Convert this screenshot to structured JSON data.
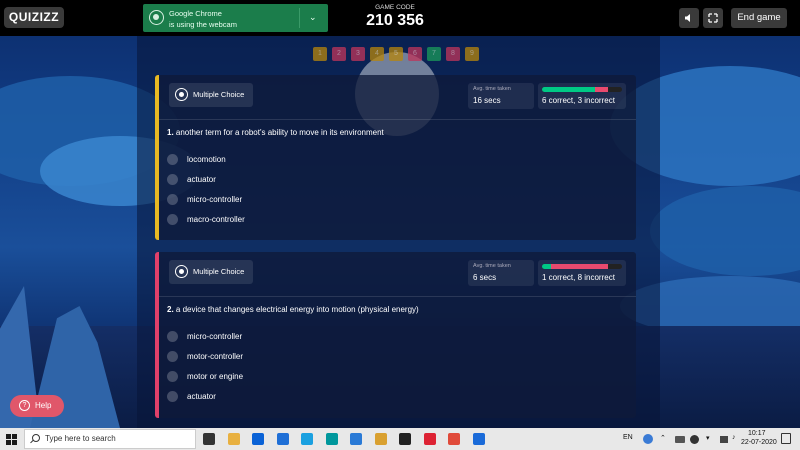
{
  "header": {
    "logo": "QUIZIZZ",
    "webcam_notice": {
      "line1": "Google Chrome",
      "line2": "is using the webcam"
    },
    "game_code_label": "GAME CODE",
    "game_code": "210 356",
    "mute_icon": "speaker-icon",
    "fullscreen_icon": "fullscreen-icon",
    "end_game_label": "End game"
  },
  "question_nav": {
    "items": [
      {
        "label": "1",
        "color": "#b8860b"
      },
      {
        "label": "2",
        "color": "#c0355a"
      },
      {
        "label": "3",
        "color": "#c0355a"
      },
      {
        "label": "4",
        "color": "#b8860b"
      },
      {
        "label": "5",
        "color": "#b8860b"
      },
      {
        "label": "6",
        "color": "#c0355a"
      },
      {
        "label": "7",
        "color": "#1a9a5a"
      },
      {
        "label": "8",
        "color": "#c0355a"
      },
      {
        "label": "9",
        "color": "#b8860b"
      }
    ]
  },
  "questions": [
    {
      "type_label": "Multiple Choice",
      "stripe_color": "#e8b923",
      "avg_time_label": "Avg. time taken",
      "avg_time_value": "16 secs",
      "accuracy_label": "6 correct, 3 incorrect",
      "correct_fraction": 0.667,
      "number": "1.",
      "text": "another term for a robot's ability to move in its environment",
      "options": [
        "locomotion",
        "actuator",
        "micro-controller",
        "macro-controller"
      ]
    },
    {
      "type_label": "Multiple Choice",
      "stripe_color": "#e0406a",
      "avg_time_label": "Avg. time taken",
      "avg_time_value": "6 secs",
      "accuracy_label": "1 correct, 8 incorrect",
      "correct_fraction": 0.111,
      "number": "2.",
      "text": "a device that changes electrical energy into motion (physical energy)",
      "options": [
        "micro-controller",
        "motor-controller",
        "motor or engine",
        "actuator"
      ]
    }
  ],
  "help_label": "Help",
  "taskbar": {
    "search_placeholder": "Type here to search",
    "language": "EN",
    "time": "10:17",
    "date": "22-07-2020",
    "app_icons": [
      "task-view-icon",
      "file-explorer-icon",
      "dropbox-icon",
      "mail-icon",
      "skype-icon",
      "arduino-icon",
      "store-icon",
      "paint-icon",
      "obs-icon",
      "app-icon",
      "chrome-icon",
      "documents-icon"
    ]
  }
}
